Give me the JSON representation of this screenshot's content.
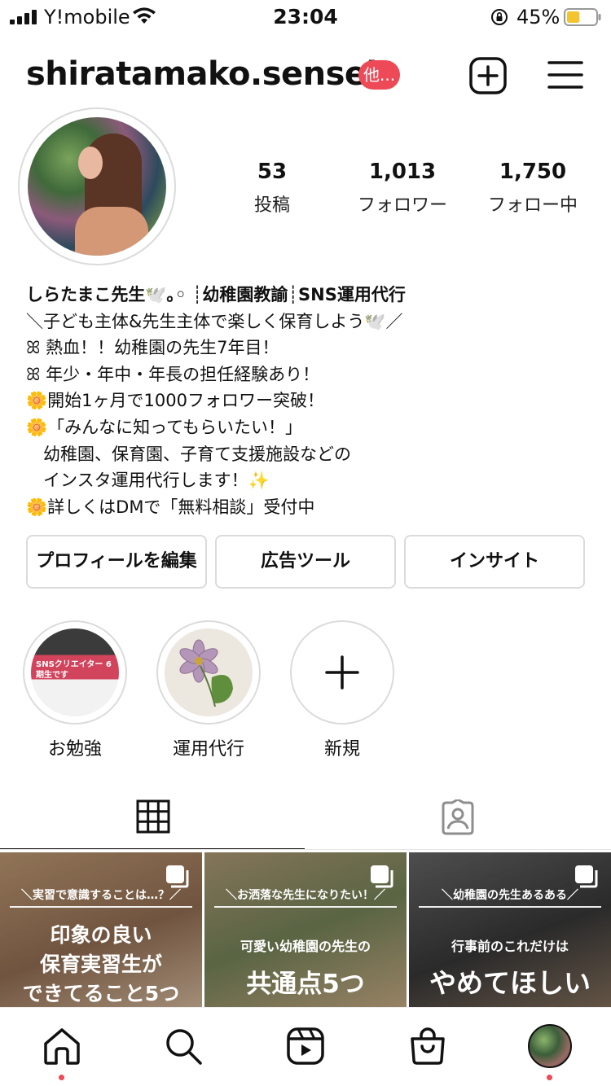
{
  "status_bar": {
    "carrier": "Y!mobile",
    "time": "23:04",
    "battery_percent": "45%",
    "battery_level": 0.45,
    "icons": [
      "signal-icon",
      "wifi-icon",
      "orientation-lock-icon",
      "battery-icon"
    ]
  },
  "header": {
    "username": "shiratamako.sensei",
    "others_badge": "他...",
    "accent": "#ed4956",
    "icons": [
      "new-post-icon",
      "menu-icon"
    ]
  },
  "profile": {
    "stats": [
      {
        "value": "53",
        "label": "投稿"
      },
      {
        "value": "1,013",
        "label": "フォロワー"
      },
      {
        "value": "1,750",
        "label": "フォロー中"
      }
    ]
  },
  "bio": {
    "lines": [
      "しらたまこ先生🕊️｡◦ ┊幼稚園教諭┊SNS運用代行",
      "＼子ども主体&先生主体で楽しく保育しよう🕊️／",
      "ꕤ 熱血！！幼稚園の先生7年目！",
      "ꕤ 年少・年中・年長の担任経験あり！",
      "🌼開始1ヶ月で1000フォロワー突破！",
      "🌼「みんなに知ってもらいたい！」",
      "　幼稚園、保育園、子育て支援施設などの",
      "　インスタ運用代行します！✨",
      "🌼詳しくはDMで「無料相談」受付中"
    ]
  },
  "actions": {
    "edit_profile": "プロフィールを編集",
    "ad_tools": "広告ツール",
    "insights": "インサイト"
  },
  "highlights": [
    {
      "label": "お勉強",
      "cover_text": "SNSクリエイター 6期生です"
    },
    {
      "label": "運用代行"
    },
    {
      "label": "新規"
    }
  ],
  "tabs": {
    "items": [
      "grid-icon",
      "tagged-icon"
    ],
    "active": "grid"
  },
  "posts": [
    {
      "subtitle": "＼実習で意識することは…？／",
      "lines": [
        "印象の良い",
        "保育実習生が",
        "できてること5つ"
      ]
    },
    {
      "subtitle": "＼お洒落な先生になりたい！／",
      "lines": [
        "可愛い幼稚園の先生の",
        "共通点5つ"
      ]
    },
    {
      "subtitle": "＼幼稚園の先生あるある／",
      "lines": [
        "行事前のこれだけは",
        "やめてほしい"
      ]
    }
  ],
  "bottom_nav": {
    "items": [
      "home-icon",
      "search-icon",
      "reels-icon",
      "shop-icon",
      "profile-avatar"
    ]
  }
}
